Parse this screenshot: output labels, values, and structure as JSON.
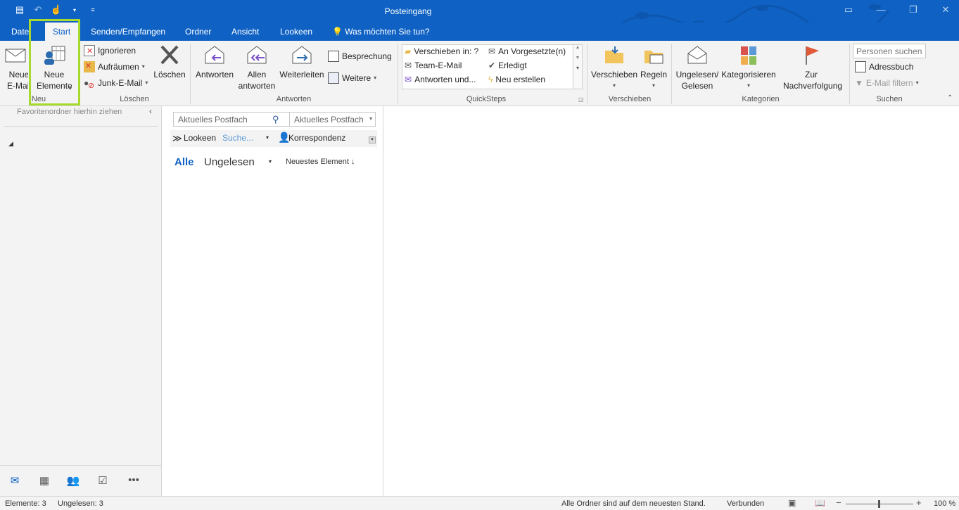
{
  "window": {
    "title": "Posteingang"
  },
  "tabs": [
    {
      "label": "Datei"
    },
    {
      "label": "Start"
    },
    {
      "label": "Senden/Empfangen"
    },
    {
      "label": "Ordner"
    },
    {
      "label": "Ansicht"
    },
    {
      "label": "Lookeen"
    },
    {
      "label": "Was möchten Sie tun?"
    }
  ],
  "ribbon": {
    "neu": {
      "group_label": "Neu",
      "new_mail": "Neue E-Mail",
      "new_items": "Neue Elemente"
    },
    "loeschen": {
      "group_label": "Löschen",
      "ignore": "Ignorieren",
      "cleanup": "Aufräumen",
      "junk": "Junk-E-Mail",
      "delete": "Löschen"
    },
    "antworten": {
      "group_label": "Antworten",
      "reply": "Antworten",
      "reply_all": "Allen antworten",
      "forward": "Weiterleiten",
      "meeting": "Besprechung",
      "more": "Weitere"
    },
    "quicksteps": {
      "group_label": "QuickSteps",
      "items": [
        "Verschieben in: ?",
        "An Vorgesetzte(n)",
        "Team-E-Mail",
        "Erledigt",
        "Antworten und...",
        "Neu erstellen"
      ]
    },
    "verschieben": {
      "group_label": "Verschieben",
      "move": "Verschieben",
      "rules": "Regeln"
    },
    "kategorien": {
      "group_label": "Kategorien",
      "unread_read": "Ungelesen/ Gelesen",
      "categorize": "Kategorisieren",
      "followup": "Zur Nachverfolgung"
    },
    "suchen": {
      "group_label": "Suchen",
      "people_placeholder": "Personen suchen",
      "address_book": "Adressbuch",
      "filter_mail": "E-Mail filtern"
    }
  },
  "folder_pane": {
    "favorites_hint": "Favoritenordner hierhin ziehen"
  },
  "message_list": {
    "search_placeholder": "Aktuelles Postfach",
    "search_scope": "Aktuelles Postfach",
    "lookeen_label": "Lookeen",
    "lookeen_input": "Suche...",
    "lookeen_filter": "Korrespondenz",
    "filter_all": "Alle",
    "filter_unread": "Ungelesen",
    "sort_label": "Neuestes Element"
  },
  "statusbar": {
    "items": "Elemente: 3",
    "unread": "Ungelesen: 3",
    "sync": "Alle Ordner sind auf dem neuesten Stand.",
    "connection": "Verbunden",
    "zoom": "100 %"
  },
  "colors": {
    "accent": "#0f62c4",
    "highlight": "#a7d92f"
  }
}
